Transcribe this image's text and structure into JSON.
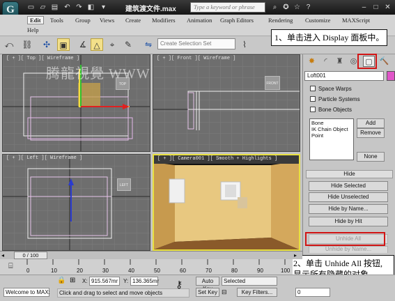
{
  "titlebar": {
    "logo": "G",
    "title": "建筑渡文件.max",
    "search_placeholder": "Type a keyword or phrase"
  },
  "menu": [
    "Edit",
    "Tools",
    "Group",
    "Views",
    "Create",
    "Modifiers",
    "Animation",
    "Graph Editors",
    "Rendering",
    "Customize",
    "MAXScript",
    "Help"
  ],
  "toolbar": {
    "selection_set_placeholder": "Create Selection Set"
  },
  "watermark": "腾龍視覺 WWW.TLVI.NET",
  "viewports": {
    "top_label": "[ + ][ Top ][ Wireframe ]",
    "top_cube_label": "TOP",
    "front_label": "[ + ][ Front ][ Wireframe ]",
    "front_cube_label": "FRONT",
    "left_label": "[ + ][ Left ][ Wireframe ]",
    "left_cube_label": "LEFT",
    "camera_label": "[ + ][ Camera001 ][ Smooth + Highlights ]"
  },
  "panel": {
    "object_name": "Loft001",
    "object_color": "#e055c8",
    "categories": [
      "Space Warps",
      "Particle Systems",
      "Bone Objects"
    ],
    "list_items": [
      "Bone",
      "IK Chain Object",
      "Point"
    ],
    "add": "Add",
    "remove": "Remove",
    "none": "None",
    "hide_header": "Hide",
    "hide_buttons": [
      "Hide Selected",
      "Hide Unselected",
      "Hide by Name...",
      "Hide by Hit"
    ],
    "unhide_all": "Unhide All",
    "unhide_by_name": "Unhide by Name..."
  },
  "callouts": {
    "step1": "1、单击进入 Display 面板中。",
    "step2_line1": "2、单击 Unhide All 按钮,",
    "step2_line2": "显示所有隐藏的对象。"
  },
  "timeline": {
    "frame": "0 / 100",
    "ticks": [
      "0",
      "10",
      "20",
      "30",
      "40",
      "50",
      "60",
      "70",
      "80",
      "90",
      "100"
    ]
  },
  "status": {
    "maxscript": "Welcome to MAX:",
    "x_label": "X:",
    "x_value": "915.567mr",
    "y_label": "Y:",
    "y_value": "136.365mr",
    "auto_key": "Auto Key",
    "set_key": "Set Key",
    "selected": "Selected",
    "key_filters": "Key Filters...",
    "prompt": "Click and drag to select and move objects",
    "frame_field": "0"
  }
}
